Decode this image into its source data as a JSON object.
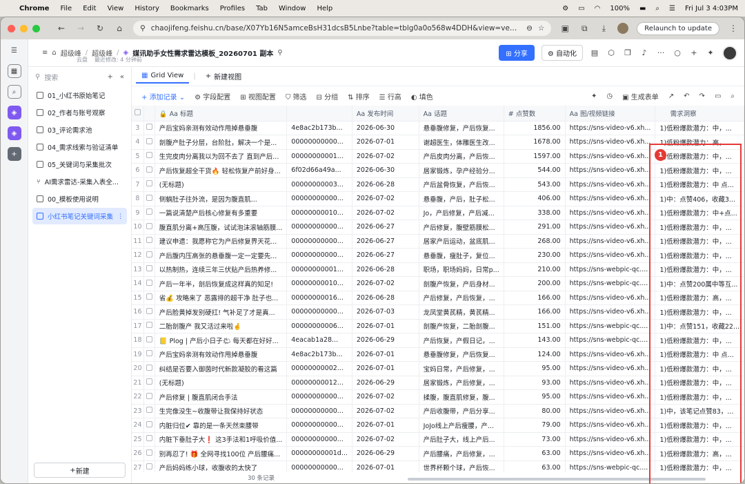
{
  "os_menu": {
    "app": "Chrome",
    "items": [
      "File",
      "Edit",
      "View",
      "History",
      "Bookmarks",
      "Profiles",
      "Tab",
      "Window",
      "Help"
    ],
    "battery": "100%",
    "datetime": "Fri Jul 3  4:03PM"
  },
  "browser": {
    "url": "chaojifeng.feishu.cn/base/X07Yb16N5amceBsH31dcsB5Lnbe?table=tblg0a0o568w4DDH&view=vewUf8Umfs",
    "relaunch": "Relaunch to update"
  },
  "header": {
    "crumb1": "超级峰",
    "crumb2": "超级峰",
    "doc_title": "媒讯助手女性需求雷达模板_20260701 副本",
    "location": "云盘",
    "modified": "最近修改: 4 分钟前",
    "share": "分享",
    "automation": "自动化"
  },
  "sidebar": {
    "search_placeholder": "搜索",
    "items": [
      {
        "label": "01_小红书原始笔记"
      },
      {
        "label": "02_作者与账号观察"
      },
      {
        "label": "03_评论需求池"
      },
      {
        "label": "04_需求线索与验证清单"
      },
      {
        "label": "05_关键词与采集批次"
      },
      {
        "label": "AI需求雷达-采集入表全..."
      },
      {
        "label": "00_模板使用说明"
      },
      {
        "label": "小红书笔记关键词采集"
      }
    ],
    "new_button": "新建"
  },
  "view_tabs": {
    "active": "Grid View",
    "new_view": "新建视图"
  },
  "toolbar": {
    "add": "添加记录",
    "fields": "字段配置",
    "view_config": "视图配置",
    "filter": "筛选",
    "group": "分组",
    "sort": "排序",
    "row_height": "行高",
    "fill": "填色",
    "gen_form": "生成表单"
  },
  "columns": {
    "title": "标题",
    "id": "",
    "publish": "发布时间",
    "topic": "话题",
    "likes": "点赞数",
    "link": "图/视频链接",
    "insight": "需求洞察"
  },
  "rows": [
    {
      "n": "3",
      "title": "产后宝妈亲测有效动作甩掉悬垂腹",
      "id": "4e8ac2b173b...",
      "date": "2026-06-30",
      "topic": "悬垂腹修复，产后恢复...",
      "likes": "1856.00",
      "link": "https://sns-video-v6.xh...",
      "insight": "1)低粉爆款潜力：中，..."
    },
    {
      "n": "4",
      "title": "剖腹产肚子分层，台阶肚，解决一个是...",
      "id": "00000000000...",
      "date": "2026-07-01",
      "topic": "谢超医生，体雕医生改...",
      "likes": "1678.00",
      "link": "https://sns-video-v6.xh...",
      "insight": "1)低粉爆款潜力：高，..."
    },
    {
      "n": "5",
      "title": "生完皮肉分离我以为回不去了 直到产后...",
      "id": "00000000001...",
      "date": "2026-07-02",
      "topic": "产后皮肉分离，产后恢...",
      "likes": "1597.00",
      "link": "https://sns-video-v6.xh...",
      "insight": "1)低粉爆款潜力：中，..."
    },
    {
      "n": "6",
      "title": "产后恢复超全干货🔥 轻松恢复产前好身...",
      "id": "6f02d66a49a...",
      "date": "2026-06-30",
      "topic": "居家锻炼，孕产经验分...",
      "likes": "544.00",
      "link": "https://sns-video-v6.xh...",
      "insight": "1)低粉爆款潜力：中，..."
    },
    {
      "n": "7",
      "title": "(无标题)",
      "id": "00000000003...",
      "date": "2026-06-28",
      "topic": "产后盆骨恢复，产后恢...",
      "likes": "543.00",
      "link": "https://sns-video-v6.xh...",
      "insight": "1)低粉爆款潜力：中 点..."
    },
    {
      "n": "8",
      "title": "侧躺肚子往外流，是因为腹直肌...",
      "id": "00000000000...",
      "date": "2026-07-02",
      "topic": "悬垂腹，产后，肚子松...",
      "likes": "406.00",
      "link": "https://sns-video-v6.xh...",
      "insight": "1)中：点赞406，收藏3..."
    },
    {
      "n": "9",
      "title": "一篇说清楚产后核心修复有多重要",
      "id": "00000000010...",
      "date": "2026-07-02",
      "topic": "Jo，产后修复，产后减...",
      "likes": "338.00",
      "link": "https://sns-video-v6.xh...",
      "insight": "1)低粉爆款潜力：中+点..."
    },
    {
      "n": "10",
      "title": "腹直肌分离+高压腹，试试泡沫滚轴筋膜...",
      "id": "00000000000...",
      "date": "2026-06-27",
      "topic": "产后修复，腹壁筋膜松...",
      "likes": "291.00",
      "link": "https://sns-video-v6.xh...",
      "insight": "1)低粉爆款潜力：中，..."
    },
    {
      "n": "11",
      "title": "建议申遗：我愿称它为产后修复界天花...",
      "id": "00000000000...",
      "date": "2026-06-27",
      "topic": "居家产后运动，盆底肌...",
      "likes": "268.00",
      "link": "https://sns-video-v6.xh...",
      "insight": "1)低粉爆款潜力：中，..."
    },
    {
      "n": "12",
      "title": "产后腹内压高张的悬垂腹一定一定要先...",
      "id": "00000000000...",
      "date": "2026-06-27",
      "topic": "悬垂腹，瘦肚子，复位...",
      "likes": "230.00",
      "link": "https://sns-video-v6.xh...",
      "insight": "1)低粉爆款潜力：中，..."
    },
    {
      "n": "13",
      "title": "以热制热，连续三年三伏贴产后热养修...",
      "id": "00000000001...",
      "date": "2026-06-28",
      "topic": "职场，职场妈妈，日常p...",
      "likes": "210.00",
      "link": "https://sns-webpic-qc....",
      "insight": "1)低粉爆款潜力：中，..."
    },
    {
      "n": "14",
      "title": "产后一年半，剖后恢复成这样真的知足!",
      "id": "00000000010...",
      "date": "2026-07-02",
      "topic": "剖腹产恢复，产后身材...",
      "likes": "200.00",
      "link": "https://sns-webpic-qc....",
      "insight": "1)中：点赞200属中等互..."
    },
    {
      "n": "15",
      "title": "省💰 攻略来了 恶露排的超干净 肚子也...",
      "id": "00000000016...",
      "date": "2026-06-28",
      "topic": "产后修复，产后恢复，...",
      "likes": "166.00",
      "link": "https://sns-video-v6.xh...",
      "insight": "1)低粉爆款潜力：高，..."
    },
    {
      "n": "16",
      "title": "产后脸黄掉发别硬扛! 气补足了才是真...",
      "id": "00000000000...",
      "date": "2026-07-03",
      "topic": "龙凤堂黄芪精，黄芪精...",
      "likes": "166.00",
      "link": "https://sns-video-v6.xh...",
      "insight": "1)低粉爆款潜力：中，..."
    },
    {
      "n": "17",
      "title": "二胎剖腹产 我又活过来啦🤞",
      "id": "00000000006...",
      "date": "2026-07-01",
      "topic": "剖腹产恢复，二胎剖腹...",
      "likes": "151.00",
      "link": "https://sns-webpic-qc....",
      "insight": "1)中：点赞151，收藏22..."
    },
    {
      "n": "18",
      "title": "📒 Plog | 产后小日子🌤 每天都在好好...",
      "id": "4eacab1a28...",
      "date": "2026-06-29",
      "topic": "产后恢复，产假日记，...",
      "likes": "143.00",
      "link": "https://sns-webpic-qc....",
      "insight": "1)低粉爆款潜力：中，..."
    },
    {
      "n": "19",
      "title": "产后宝妈亲测有效动作甩掉悬垂腹",
      "id": "4e8ac2b173b...",
      "date": "2026-07-01",
      "topic": "悬垂腹修复，产后恢复...",
      "likes": "124.00",
      "link": "https://sns-video-v6.xh...",
      "insight": "1)低粉爆款潜力：中 点..."
    },
    {
      "n": "20",
      "title": "纠结是否要入御茵时代新款凝胶的看这篇",
      "id": "00000000002...",
      "date": "2026-07-01",
      "topic": "宝妈日常，产后修复，...",
      "likes": "95.00",
      "link": "https://sns-video-v6.xh...",
      "insight": "1)低粉爆款潜力：中，..."
    },
    {
      "n": "21",
      "title": "(无标题)",
      "id": "00000000012...",
      "date": "2026-06-29",
      "topic": "居家锻炼，产后修复，...",
      "likes": "93.00",
      "link": "https://sns-video-v6.xh...",
      "insight": "1)低粉爆款潜力：中，..."
    },
    {
      "n": "22",
      "title": "产后修复 | 腹直肌闭合手法",
      "id": "00000000000...",
      "date": "2026-07-02",
      "topic": "揉腹，腹直肌修复，腹...",
      "likes": "95.00",
      "link": "https://sns-video-v6.xh...",
      "insight": "1)低粉爆款潜力：中，..."
    },
    {
      "n": "23",
      "title": "生完像没生~收腹带让我保持好状态",
      "id": "00000000000...",
      "date": "2026-07-02",
      "topic": "产后收腹带，产后分享...",
      "likes": "80.00",
      "link": "https://sns-video-v6.xh...",
      "insight": "1)中，该笔记点赞83，..."
    },
    {
      "n": "24",
      "title": "内脏归位✔ 靠的是一条天然束腰带",
      "id": "00000000000...",
      "date": "2026-07-01",
      "topic": "JoJo线上产后瘦腰，产...",
      "likes": "79.00",
      "link": "https://sns-video-v6.xh...",
      "insight": "1)低粉爆款潜力：中，..."
    },
    {
      "n": "25",
      "title": "内脏下垂肚子大❗ 这3手法和1呼吸价值...",
      "id": "00000000000...",
      "date": "2026-07-02",
      "topic": "产后肚子大，线上产后...",
      "likes": "73.00",
      "link": "https://sns-video-v6.xh...",
      "insight": "1)低粉爆款潜力：中，..."
    },
    {
      "n": "26",
      "title": "别再忍了! 🎁 全网寻找100位 产后腰痛...",
      "id": "00000000001d...",
      "date": "2026-06-29",
      "topic": "产后腰痛，产后修复，...",
      "likes": "63.00",
      "link": "https://sns-video-v6.xh...",
      "insight": "1)低粉爆款潜力：高，..."
    },
    {
      "n": "27",
      "title": "产后妈妈练小球，收腹收的太快了",
      "id": "00000000000...",
      "date": "2026-07-01",
      "topic": "世界杯颗个球，产后恢...",
      "likes": "63.00",
      "link": "https://sns-webpic-qc....",
      "insight": "1)低粉爆款潜力：中，..."
    }
  ],
  "footer": {
    "count": "30 条记录"
  },
  "annotation": {
    "badge": "1"
  }
}
